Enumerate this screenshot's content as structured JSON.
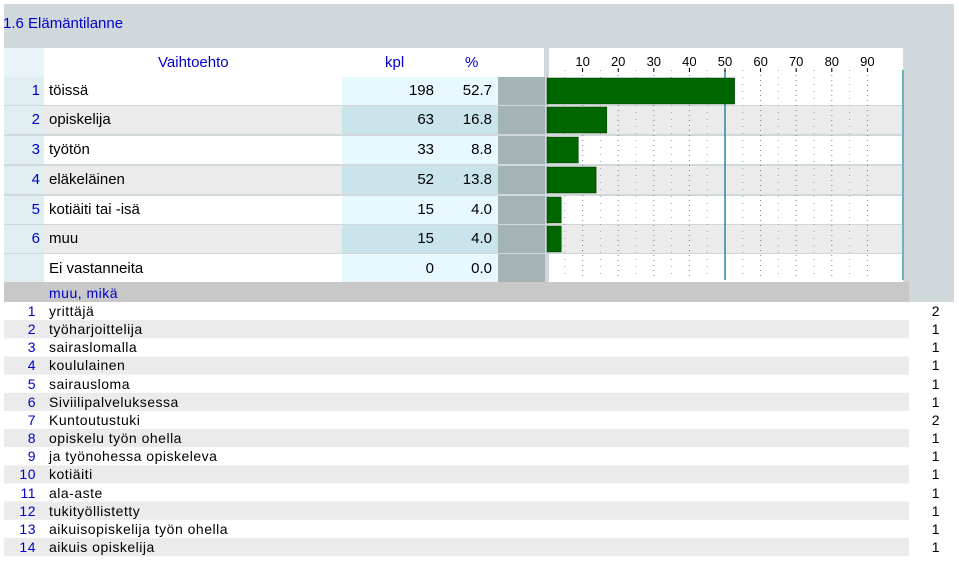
{
  "title": "1.6 Elämäntilanne",
  "table": {
    "headers": {
      "option": "Vaihtoehto",
      "count": "kpl",
      "percent": "%"
    },
    "rows": [
      {
        "num": "1",
        "label": "töissä",
        "count": "198",
        "percent": "52.7"
      },
      {
        "num": "2",
        "label": "opiskelija",
        "count": "63",
        "percent": "16.8"
      },
      {
        "num": "3",
        "label": "työtön",
        "count": "33",
        "percent": "8.8"
      },
      {
        "num": "4",
        "label": "eläkeläinen",
        "count": "52",
        "percent": "13.8"
      },
      {
        "num": "5",
        "label": "kotiäiti tai -isä",
        "count": "15",
        "percent": "4.0"
      },
      {
        "num": "6",
        "label": "muu",
        "count": "15",
        "percent": "4.0"
      }
    ],
    "no_answer": {
      "label": "Ei vastanneita",
      "count": "0",
      "percent": "0.0"
    }
  },
  "chart_data": {
    "type": "bar",
    "orientation": "horizontal",
    "categories": [
      "töissä",
      "opiskelija",
      "työtön",
      "eläkeläinen",
      "kotiäiti tai -isä",
      "muu",
      "Ei vastanneita"
    ],
    "values": [
      52.7,
      16.8,
      8.8,
      13.8,
      4.0,
      4.0,
      0.0
    ],
    "xlim": [
      0,
      100
    ],
    "xticks": [
      "10",
      "20",
      "30",
      "40",
      "50",
      "60",
      "70",
      "80",
      "90"
    ],
    "grid": true,
    "bar_color": "#006600"
  },
  "other": {
    "header": "muu, mikä",
    "items": [
      {
        "num": "1",
        "text": "yrittäjä",
        "count": "2"
      },
      {
        "num": "2",
        "text": "työharjoittelija",
        "count": "1"
      },
      {
        "num": "3",
        "text": "sairaslomalla",
        "count": "1"
      },
      {
        "num": "4",
        "text": "koululainen",
        "count": "1"
      },
      {
        "num": "5",
        "text": "sairausloma",
        "count": "1"
      },
      {
        "num": "6",
        "text": "Siviilipalveluksessa",
        "count": "1"
      },
      {
        "num": "7",
        "text": "Kuntoutustuki",
        "count": "2"
      },
      {
        "num": "8",
        "text": "opiskelu työn ohella",
        "count": "1"
      },
      {
        "num": "9",
        "text": "ja työnohessa opiskeleva",
        "count": "1"
      },
      {
        "num": "10",
        "text": "kotiäiti",
        "count": "1"
      },
      {
        "num": "11",
        "text": "ala-aste",
        "count": "1"
      },
      {
        "num": "12",
        "text": "tukityöllistetty",
        "count": "1"
      },
      {
        "num": "13",
        "text": "aikuisopiskelija työn ohella",
        "count": "1"
      },
      {
        "num": "14",
        "text": "aikuis opiskelija",
        "count": "1"
      }
    ]
  }
}
